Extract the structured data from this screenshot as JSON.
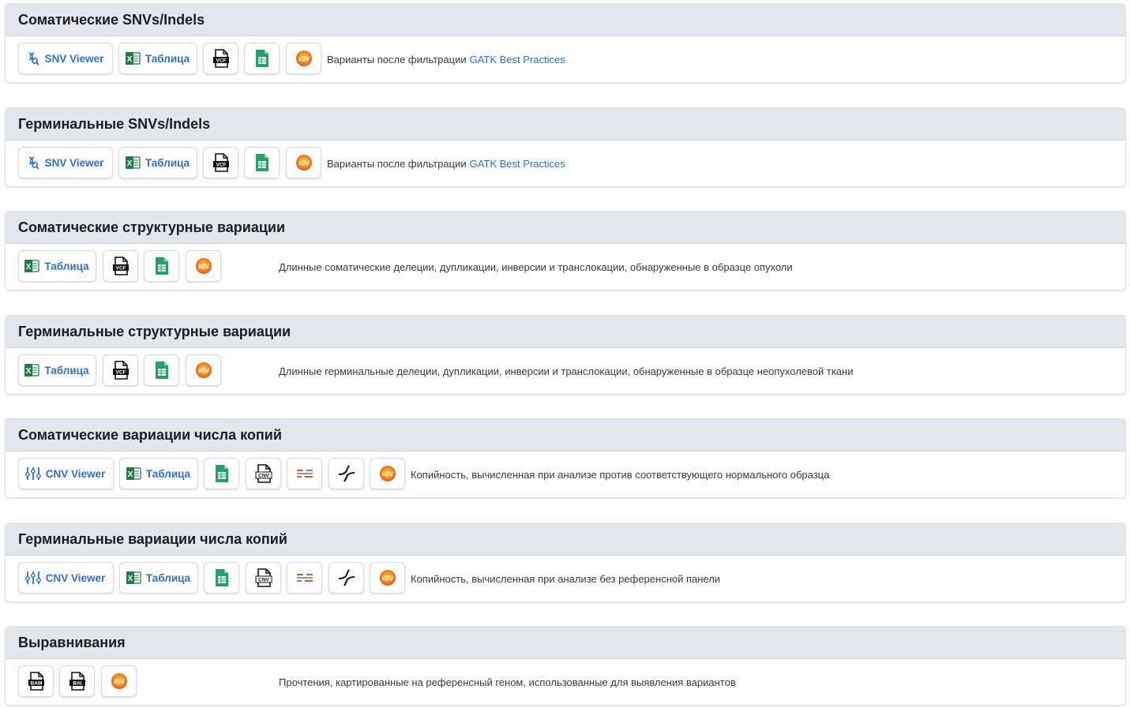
{
  "panels": [
    {
      "title": "Соматические SNVs/Indels",
      "viewer_label": "SNV Viewer",
      "table_label": "Таблица",
      "vcf_icon_text": "VCF",
      "description": "Варианты после фильтрации",
      "description_link": "GATK Best Practices"
    },
    {
      "title": "Герминальные SNVs/Indels",
      "viewer_label": "SNV Viewer",
      "table_label": "Таблица",
      "vcf_icon_text": "VCF",
      "description": "Варианты после фильтрации",
      "description_link": "GATK Best Practices"
    },
    {
      "title": "Соматические структурные вариации",
      "table_label": "Таблица",
      "vcf_icon_text": "VCF",
      "description": "Длинные соматические делеции, дупликации, инверсии и транслокации, обнаруженные в образце опухоли"
    },
    {
      "title": "Герминальные структурные вариации",
      "table_label": "Таблица",
      "vcf_icon_text": "VCF",
      "description": "Длинные герминальные делеции, дупликации, инверсии и транслокации, обнаруженные в образце неопухолевой ткани"
    },
    {
      "title": "Соматические вариации числа копий",
      "viewer_label": "CNV Viewer",
      "table_label": "Таблица",
      "cnv_icon_text": "CNV",
      "description": "Копийность, вычисленная при анализе против соответствующего нормального образца"
    },
    {
      "title": "Герминальные вариации числа копий",
      "viewer_label": "CNV Viewer",
      "table_label": "Таблица",
      "cnv_icon_text": "CNV",
      "description": "Копийность, вычисленная при анализе без референсной панели"
    },
    {
      "title": "Выравнивания",
      "bam_icon_text": "BAM",
      "bai_icon_text": "BAI",
      "description": "Прочтения, картированные на референсный геном, использованные для выявления вариантов"
    }
  ],
  "igv_icon_text": "iGV",
  "excel_icon_text": "X",
  "colors": {
    "link": "#2f6fd6",
    "header_bg": "#e4e6ed",
    "excel_green": "#1e7e45",
    "sheets_green": "#21a366",
    "igv_orange": "#f7931e"
  }
}
